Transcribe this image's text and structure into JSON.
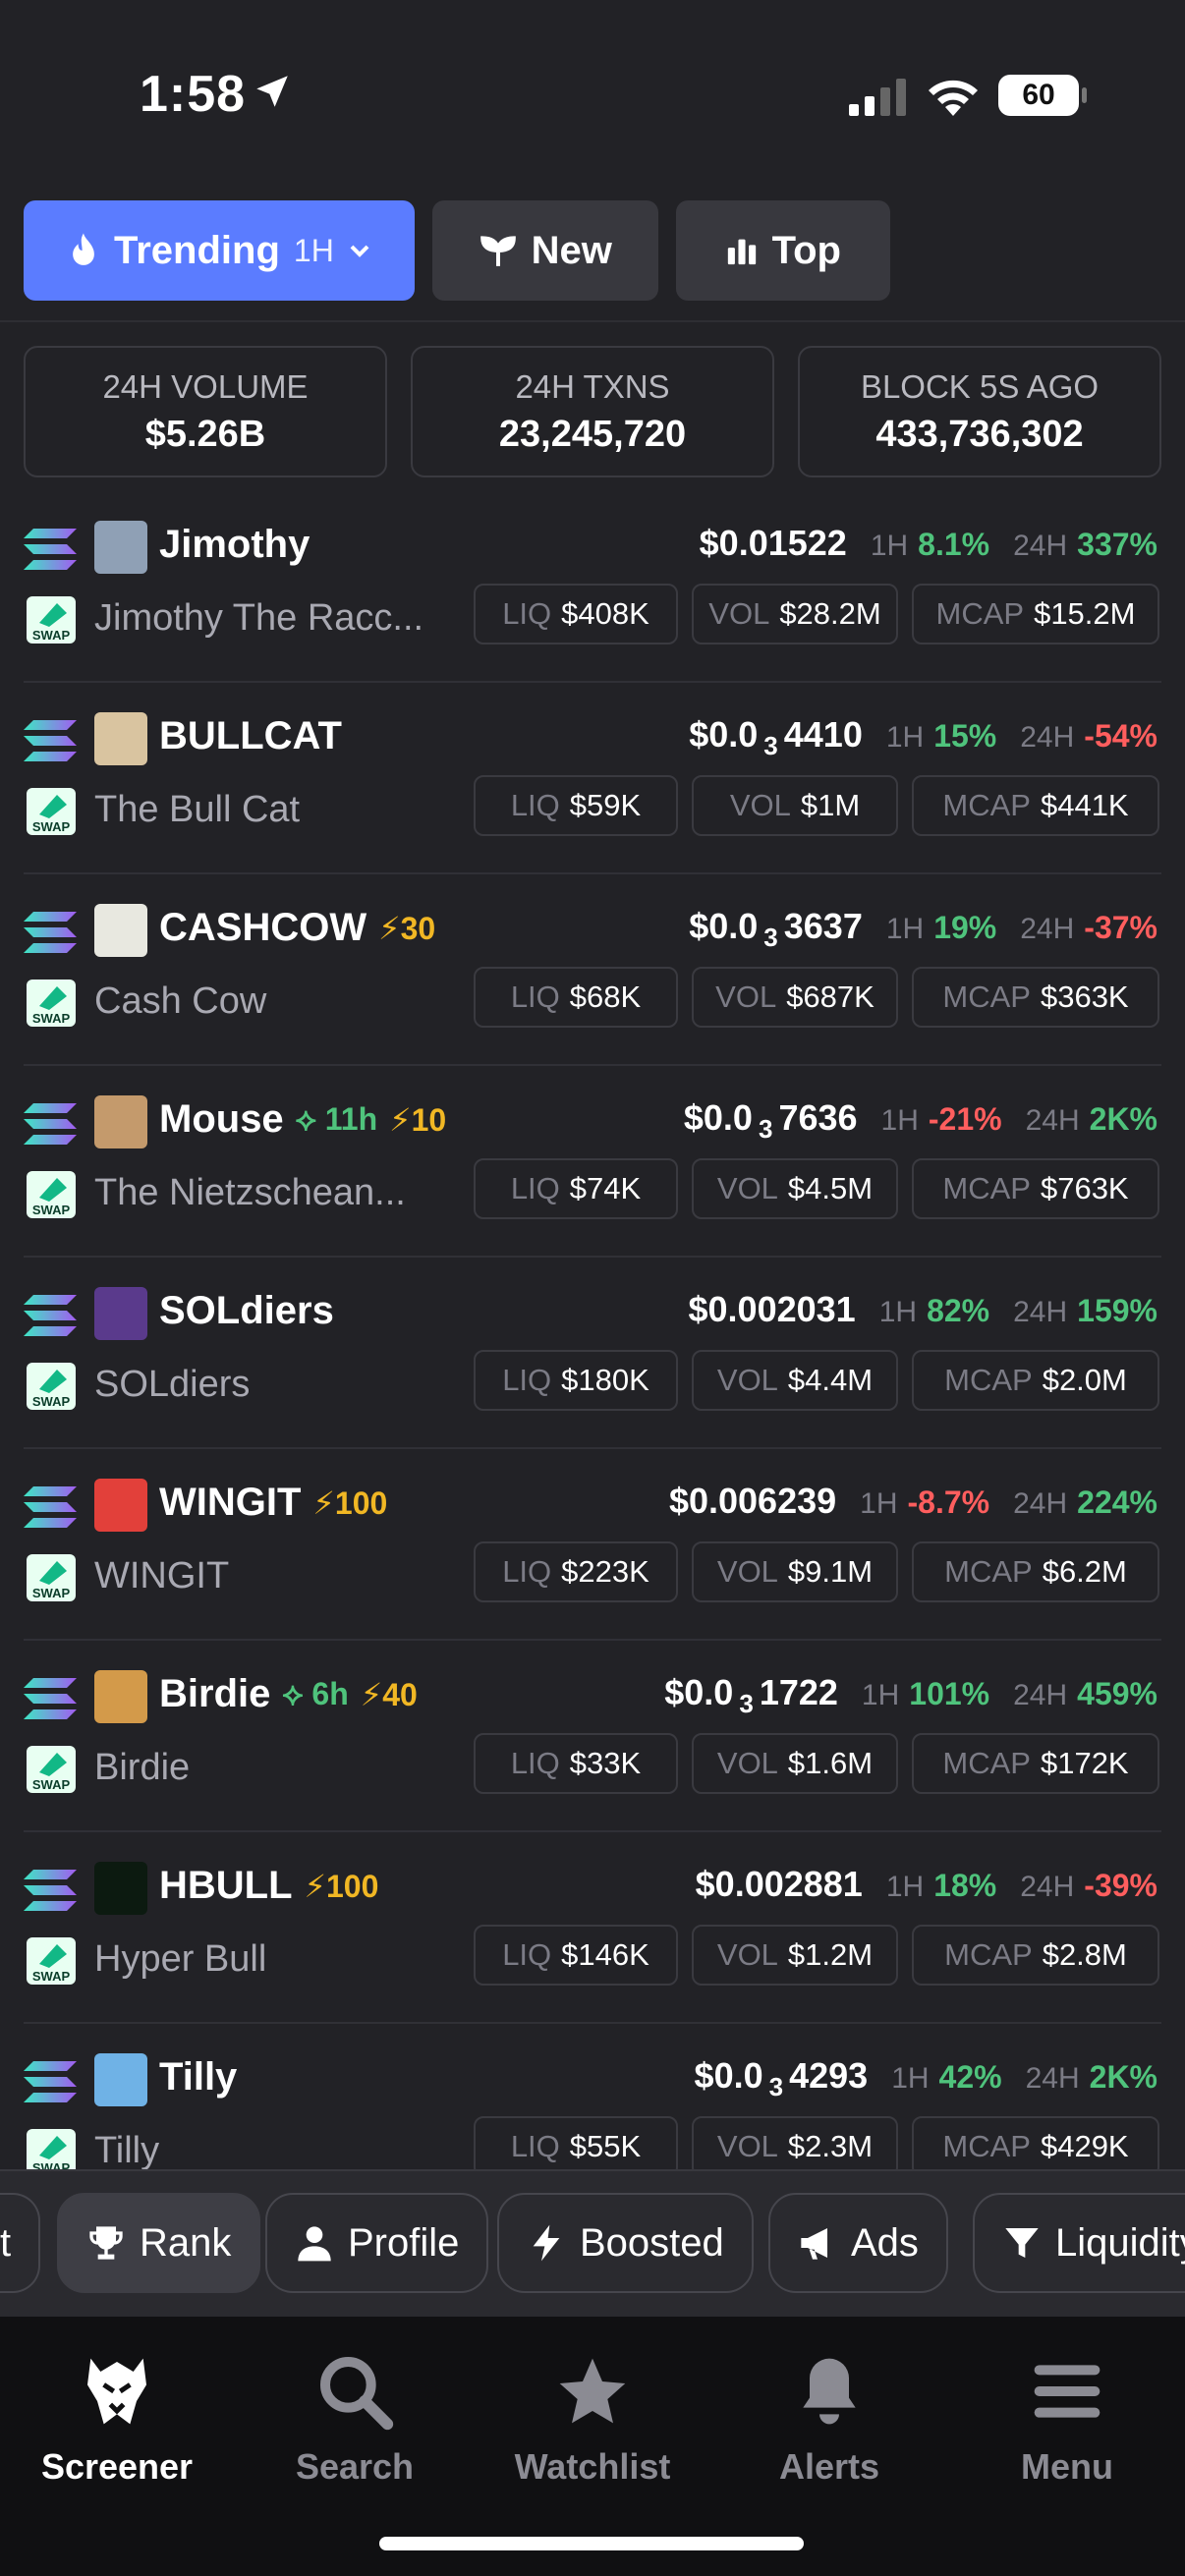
{
  "status_bar": {
    "time": "1:58",
    "battery": "60"
  },
  "tabs": [
    {
      "label": "Trending",
      "sub": "1H",
      "active": true,
      "icon": "flame-icon"
    },
    {
      "label": "New",
      "icon": "sprout-icon"
    },
    {
      "label": "Top",
      "icon": "bar-chart-icon"
    }
  ],
  "stats": [
    {
      "label": "24H VOLUME",
      "value": "$5.26B"
    },
    {
      "label": "24H TXNS",
      "value": "23,245,720"
    },
    {
      "label": "BLOCK 5S AGO",
      "value": "433,736,302"
    }
  ],
  "labels": {
    "liq": "LIQ",
    "vol": "VOL",
    "mcap": "MCAP",
    "h1": "1H",
    "h24": "24H"
  },
  "tokens": [
    {
      "symbol": "Jimothy",
      "name": "Jimothy The Racc...",
      "price_main": "$0.01522",
      "price_sub": "",
      "price_tail": "",
      "h1": "8.1%",
      "h1_dir": "up",
      "h24": "337%",
      "h24_dir": "up",
      "liq": "$408K",
      "vol": "$28.2M",
      "mcap": "$15.2M",
      "age": "",
      "boost": "",
      "avatar_color": "#8fa0b5"
    },
    {
      "symbol": "BULLCAT",
      "name": "The Bull Cat",
      "price_main": "$0.0",
      "price_sub": "3",
      "price_tail": "4410",
      "h1": "15%",
      "h1_dir": "up",
      "h24": "-54%",
      "h24_dir": "dn",
      "liq": "$59K",
      "vol": "$1M",
      "mcap": "$441K",
      "age": "",
      "boost": "",
      "avatar_color": "#d9c4a0"
    },
    {
      "symbol": "CASHCOW",
      "name": "Cash Cow",
      "price_main": "$0.0",
      "price_sub": "3",
      "price_tail": "3637",
      "h1": "19%",
      "h1_dir": "up",
      "h24": "-37%",
      "h24_dir": "dn",
      "liq": "$68K",
      "vol": "$687K",
      "mcap": "$363K",
      "age": "",
      "boost": "30",
      "avatar_color": "#e8e8e0"
    },
    {
      "symbol": "Mouse",
      "name": "The Nietzschean...",
      "price_main": "$0.0",
      "price_sub": "3",
      "price_tail": "7636",
      "h1": "-21%",
      "h1_dir": "dn",
      "h24": "2K%",
      "h24_dir": "up",
      "liq": "$74K",
      "vol": "$4.5M",
      "mcap": "$763K",
      "age": "11h",
      "boost": "10",
      "avatar_color": "#c49a6c"
    },
    {
      "symbol": "SOLdiers",
      "name": "SOLdiers",
      "price_main": "$0.002031",
      "price_sub": "",
      "price_tail": "",
      "h1": "82%",
      "h1_dir": "up",
      "h24": "159%",
      "h24_dir": "up",
      "liq": "$180K",
      "vol": "$4.4M",
      "mcap": "$2.0M",
      "age": "",
      "boost": "",
      "avatar_color": "#5a3a8c"
    },
    {
      "symbol": "WINGIT",
      "name": "WINGIT",
      "price_main": "$0.006239",
      "price_sub": "",
      "price_tail": "",
      "h1": "-8.7%",
      "h1_dir": "dn",
      "h24": "224%",
      "h24_dir": "up",
      "liq": "$223K",
      "vol": "$9.1M",
      "mcap": "$6.2M",
      "age": "",
      "boost": "100",
      "avatar_color": "#e2403a"
    },
    {
      "symbol": "Birdie",
      "name": "Birdie",
      "price_main": "$0.0",
      "price_sub": "3",
      "price_tail": "1722",
      "h1": "101%",
      "h1_dir": "up",
      "h24": "459%",
      "h24_dir": "up",
      "liq": "$33K",
      "vol": "$1.6M",
      "mcap": "$172K",
      "age": "6h",
      "boost": "40",
      "avatar_color": "#d39a4a"
    },
    {
      "symbol": "HBULL",
      "name": "Hyper Bull",
      "price_main": "$0.002881",
      "price_sub": "",
      "price_tail": "",
      "h1": "18%",
      "h1_dir": "up",
      "h24": "-39%",
      "h24_dir": "dn",
      "liq": "$146K",
      "vol": "$1.2M",
      "mcap": "$2.8M",
      "age": "",
      "boost": "100",
      "avatar_color": "#0c1a10"
    },
    {
      "symbol": "Tilly",
      "name": "Tilly",
      "price_main": "$0.0",
      "price_sub": "3",
      "price_tail": "4293",
      "h1": "42%",
      "h1_dir": "up",
      "h24": "2K%",
      "h24_dir": "up",
      "liq": "$55K",
      "vol": "$2.3M",
      "mcap": "$429K",
      "age": "",
      "boost": "",
      "avatar_color": "#6fb2e6"
    }
  ],
  "filters": [
    {
      "label": "t",
      "icon": ""
    },
    {
      "label": "Rank",
      "icon": "trophy-icon",
      "selected": true
    },
    {
      "label": "Profile",
      "icon": "user-icon"
    },
    {
      "label": "Boosted",
      "icon": "bolt-icon"
    },
    {
      "label": "Ads",
      "icon": "megaphone-icon"
    },
    {
      "label": "Liquidity",
      "icon": "filter-icon"
    }
  ],
  "nav": [
    {
      "label": "Screener",
      "icon": "eagle-icon",
      "active": true
    },
    {
      "label": "Search",
      "icon": "search-icon"
    },
    {
      "label": "Watchlist",
      "icon": "star-icon"
    },
    {
      "label": "Alerts",
      "icon": "bell-icon"
    },
    {
      "label": "Menu",
      "icon": "menu-icon"
    }
  ],
  "colors": {
    "accent": "#5b7cff",
    "up": "#4fc37c",
    "down": "#ff5e5e",
    "boost": "#f1b724"
  }
}
